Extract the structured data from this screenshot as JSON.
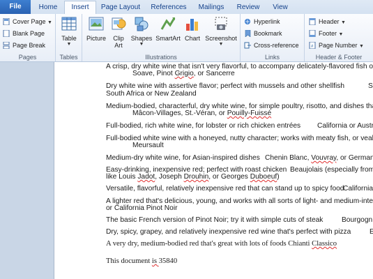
{
  "tabs": [
    "File",
    "Home",
    "Insert",
    "Page Layout",
    "References",
    "Mailings",
    "Review",
    "View"
  ],
  "ribbon": {
    "pages": {
      "label": "Pages",
      "items": [
        "Cover Page",
        "Blank Page",
        "Page Break"
      ]
    },
    "tables": {
      "label": "Tables",
      "table": "Table"
    },
    "illustrations": {
      "label": "Illustrations",
      "picture": "Picture",
      "clipart1": "Clip",
      "clipart2": "Art",
      "shapes": "Shapes",
      "smartart": "SmartArt",
      "chart": "Chart",
      "screenshot": "Screenshot"
    },
    "links": {
      "label": "Links",
      "items": [
        "Hyperlink",
        "Bookmark",
        "Cross-reference"
      ]
    },
    "header_footer": {
      "label": "Header & Footer",
      "items": [
        "Header",
        "Footer",
        "Page Number"
      ]
    }
  },
  "document": {
    "l1": "A crisp, dry white wine that isn't very flavorful, to accompany delicately-flavored fish or",
    "l1b_pre": "Soave, Pinot ",
    "l1b_sq": "Grigio",
    "l1b_post": ", or Sancerre",
    "l2": "Dry white wine with assertive flavor;  perfect with mussels and other shellfish",
    "l2_right": "S",
    "l2b": "South Africa or New Zealand",
    "l3": "Medium-bodied, characterful, dry white wine, for simple poultry, risotto, and dishes that",
    "l3b_pre": "Mâcon-Villages, St.-Véran, or ",
    "l3b_sq": "Pouilly-Fuissé",
    "l4": "Full-bodied, rich white wine, for lobster or rich chicken entrées",
    "l4_right": "California or Austr",
    "l5": "Full-bodied white wine with a honeyed, nutty character; works with meaty fish, or veal, o",
    "l5b": "Meursault",
    "l6": "Medium-dry white wine, for Asian-inspired dishes",
    "l6_right_pre": "Chenin Blanc, ",
    "l6_right_sq": "Vouvray",
    "l6_right_post": ", or German",
    "l7": "Easy-drinking, inexpensive red; perfect with roast chicken",
    "l7_right": "Beaujolais (especially from",
    "l7b_pre": "like Louis ",
    "l7b_sq1": "Jadot",
    "l7b_mid1": ", Joseph ",
    "l7b_sq2": "Drouhin",
    "l7b_mid2": ", or Georges ",
    "l7b_sq3": "Duboeuf",
    "l7b_post": ")",
    "l8": "Versatile, flavorful, relatively inexpensive red that can stand up to spicy food",
    "l8_right": "California",
    "l9": "A lighter red that's delicious, young, and works with all sorts of light- and medium-inten",
    "l9b": "or California Pinot Noir",
    "l10": "The basic French version of Pinot Noir; try it with simple cuts of steak",
    "l10_right": "Bourgogn",
    "l11": "Dry, spicy, grapey, and relatively inexpensive red wine that's perfect with pizza",
    "l11_right": "E",
    "l12_pre": "A very dry, medium-bodied  red that's great with lots of foods Chianti ",
    "l12_sq": "Classico",
    "l13_pre": "This document ",
    "l13_sq": "is ",
    "l13_post": "35840"
  },
  "colors": {
    "accent": "#2a62b3",
    "tab_text": "#15428b",
    "spell": "#e03030"
  }
}
